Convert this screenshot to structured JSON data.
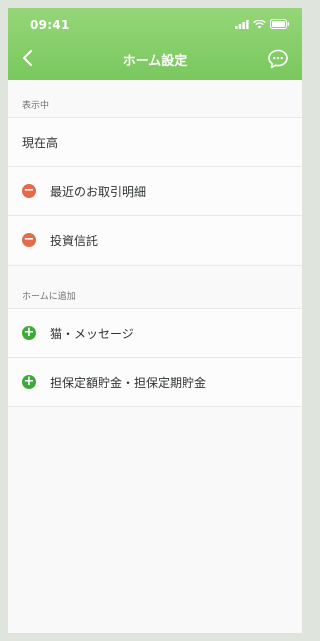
{
  "status_bar": {
    "time": "09:41"
  },
  "nav": {
    "title": "ホーム設定"
  },
  "sections": {
    "showing": {
      "header": "表示中",
      "items": [
        {
          "label": "現在高",
          "control": "none"
        },
        {
          "label": "最近のお取引明細",
          "control": "remove"
        },
        {
          "label": "投資信託",
          "control": "remove"
        }
      ]
    },
    "add": {
      "header": "ホームに追加",
      "items": [
        {
          "label": "猫・メッセージ",
          "control": "add"
        },
        {
          "label": "担保定額貯金・担保定期貯金",
          "control": "add"
        }
      ]
    }
  },
  "icons": {
    "back": "chevron-left-icon",
    "chat": "chat-bubble-icon",
    "remove": "minus-circle-icon",
    "add": "plus-circle-icon"
  },
  "colors": {
    "header_top": "#95d678",
    "header_bottom": "#79c85e",
    "remove": "#e36a4a",
    "add": "#3fa83a"
  }
}
